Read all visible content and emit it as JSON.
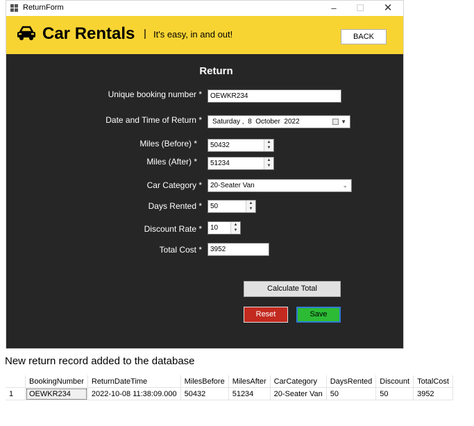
{
  "window": {
    "title": "ReturnForm",
    "min": "–",
    "max": "☐",
    "close": "✕"
  },
  "header": {
    "brand": "Car Rentals",
    "divider": "|",
    "tagline": "It's easy, in and out!",
    "back_label": "BACK",
    "colors": {
      "bar": "#f8d433"
    }
  },
  "form": {
    "title": "Return",
    "booking_label": "Unique booking number *",
    "booking_value": "OEWKR234",
    "date_label": "Date and Time of Return *",
    "date_value": "Saturday ,  8  October  2022",
    "miles_before_label": "Miles (Before) *",
    "miles_before_value": "50432",
    "miles_after_label": "Miles (After) *",
    "miles_after_value": "51234",
    "category_label": "Car Category *",
    "category_value": "20-Seater Van",
    "days_label": "Days Rented *",
    "days_value": "50",
    "discount_label": "Discount Rate *",
    "discount_value": "10",
    "total_label": "Total Cost *",
    "total_value": "3952",
    "calc_label": "Calculate Total",
    "reset_label": "Reset",
    "save_label": "Save"
  },
  "caption": "New return record added to the database",
  "db_table": {
    "columns": [
      "",
      "BookingNumber",
      "ReturnDateTime",
      "MilesBefore",
      "MilesAfter",
      "CarCategory",
      "DaysRented",
      "Discount",
      "TotalCost"
    ],
    "rows": [
      [
        "1",
        "OEWKR234",
        "2022-10-08 11:38:09.000",
        "50432",
        "51234",
        "20-Seater Van",
        "50",
        "50",
        "3952"
      ]
    ]
  }
}
